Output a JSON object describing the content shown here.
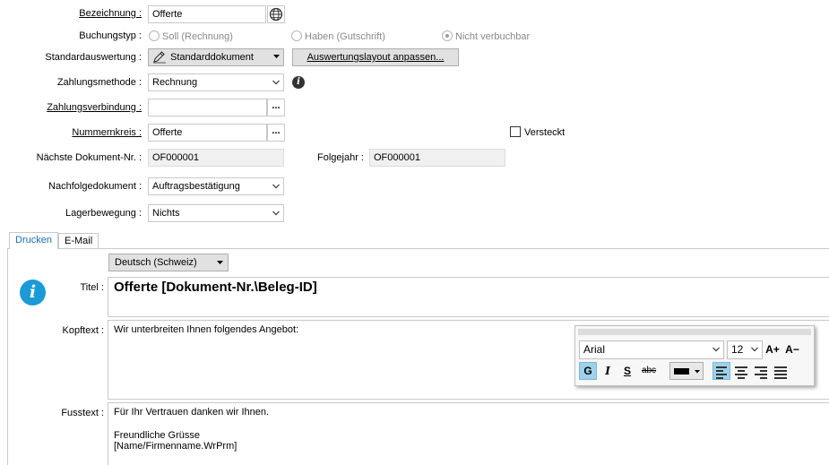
{
  "form": {
    "bezeichnung": {
      "label": "Bezeichnung :",
      "value": "Offerte"
    },
    "buchungstyp": {
      "label": "Buchungstyp :",
      "options": [
        {
          "label": "Soll (Rechnung)",
          "selected": false
        },
        {
          "label": "Haben (Gutschrift)",
          "selected": false
        },
        {
          "label": "Nicht verbuchbar",
          "selected": true
        }
      ]
    },
    "standardauswertung": {
      "label": "Standardauswertung :",
      "value": "Standarddokument",
      "layout_button": "Auswertungslayout anpassen..."
    },
    "zahlungsmethode": {
      "label": "Zahlungsmethode :",
      "value": "Rechnung"
    },
    "zahlungsverbindung": {
      "label": "Zahlungsverbindung :",
      "value": ""
    },
    "nummernkreis": {
      "label": "Nummernkreis :",
      "value": "Offerte"
    },
    "versteckt": {
      "label": "Versteckt",
      "checked": false
    },
    "naechste_dokument_nr": {
      "label": "Nächste Dokument-Nr. :",
      "value": "OF000001"
    },
    "folgejahr": {
      "label": "Folgejahr :",
      "value": "OF000001"
    },
    "nachfolgedokument": {
      "label": "Nachfolgedokument :",
      "value": "Auftragsbestätigung"
    },
    "lagerbewegung": {
      "label": "Lagerbewegung :",
      "value": "Nichts"
    },
    "dots": "..."
  },
  "tabs": [
    {
      "label": "Drucken",
      "active": true
    },
    {
      "label": "E-Mail",
      "active": false
    }
  ],
  "print": {
    "language": "Deutsch (Schweiz)",
    "titel": {
      "label": "Titel :",
      "value": "Offerte [Dokument-Nr.\\Beleg-ID]"
    },
    "kopftext": {
      "label": "Kopftext :",
      "value": "Wir unterbreiten Ihnen folgendes Angebot:"
    },
    "fusstext": {
      "label": "Fusstext :",
      "line1": "Für Ihr Vertrauen danken wir Ihnen.",
      "line2": "Freundliche Grüsse",
      "line3": "[Name/Firmenname.WrPrm]"
    }
  },
  "toolbar": {
    "font": "Arial",
    "size": "12",
    "grow": "A+",
    "shrink": "A−",
    "bold": "G",
    "italic": "I",
    "underline": "S",
    "strike": "abc"
  },
  "colors": {
    "accent": "#1a9ad6",
    "info_circle": "#1a9ad6",
    "tab_border": "#c9c9c9"
  }
}
